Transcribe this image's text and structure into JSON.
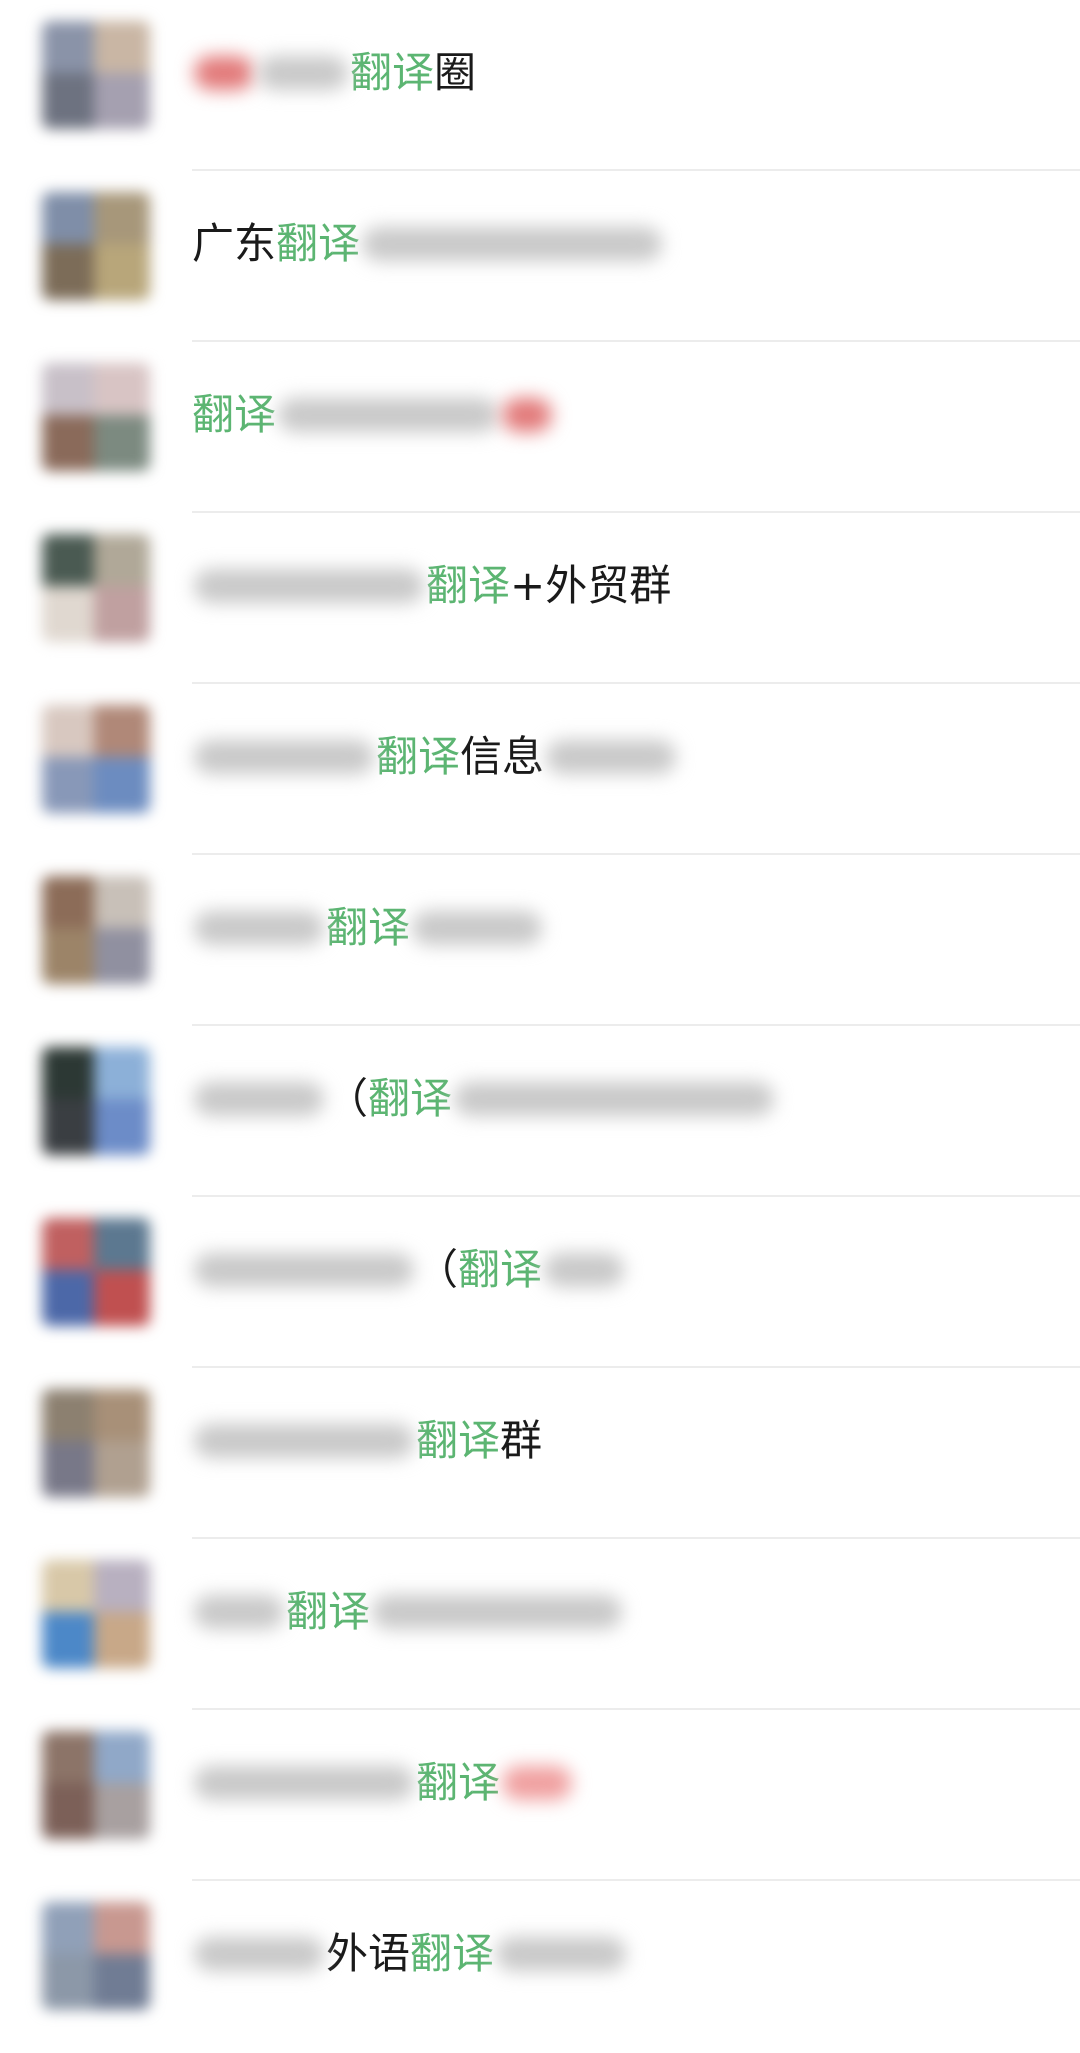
{
  "chats": [
    {
      "segments": [
        {
          "t": "blur",
          "w": 60,
          "c": "red"
        },
        {
          "t": "blur",
          "w": 90
        },
        {
          "t": "hl",
          "v": "翻译"
        },
        {
          "t": "txt",
          "v": "圈"
        }
      ],
      "avatar": [
        "#8a93a8",
        "#c9b6a4",
        "#6d7280",
        "#a5a0b0"
      ]
    },
    {
      "segments": [
        {
          "t": "txt",
          "v": "广东"
        },
        {
          "t": "hl",
          "v": "翻译"
        },
        {
          "t": "blur",
          "w": 300
        }
      ],
      "avatar": [
        "#7f8ea8",
        "#a7977a",
        "#7c6c58",
        "#b8a67a"
      ]
    },
    {
      "segments": [
        {
          "t": "hl",
          "v": "翻译"
        },
        {
          "t": "blur",
          "w": 220
        },
        {
          "t": "blur",
          "w": 50,
          "c": "red"
        }
      ],
      "avatar": [
        "#c8c0c8",
        "#d8c4c4",
        "#8a6a5a",
        "#7c8a80"
      ]
    },
    {
      "segments": [
        {
          "t": "blur",
          "w": 230
        },
        {
          "t": "hl",
          "v": "翻译"
        },
        {
          "t": "txt",
          "v": "+外贸群"
        }
      ],
      "avatar": [
        "#4a5a52",
        "#b0a898",
        "#e0d8d0",
        "#c0a0a0"
      ]
    },
    {
      "segments": [
        {
          "t": "blur",
          "w": 180
        },
        {
          "t": "hl",
          "v": "翻译"
        },
        {
          "t": "txt",
          "v": "信息"
        },
        {
          "t": "blur",
          "w": 130
        }
      ],
      "avatar": [
        "#d8c8c0",
        "#b08878",
        "#8898b8",
        "#6c8cc0"
      ]
    },
    {
      "segments": [
        {
          "t": "blur",
          "w": 130
        },
        {
          "t": "hl",
          "v": "翻译"
        },
        {
          "t": "blur",
          "w": 130
        }
      ],
      "avatar": [
        "#8c6c58",
        "#c8c0b8",
        "#9c8468",
        "#9090a0"
      ]
    },
    {
      "segments": [
        {
          "t": "blur",
          "w": 130
        },
        {
          "t": "txt",
          "v": "（"
        },
        {
          "t": "hl",
          "v": "翻译"
        },
        {
          "t": "blur",
          "w": 320
        }
      ],
      "avatar": [
        "#2c3834",
        "#8cb0d8",
        "#3a3e42",
        "#6c8cc8"
      ]
    },
    {
      "segments": [
        {
          "t": "blur",
          "w": 220
        },
        {
          "t": "txt",
          "v": "（"
        },
        {
          "t": "hl",
          "v": "翻译"
        },
        {
          "t": "blur",
          "w": 80
        }
      ],
      "avatar": [
        "#c06060",
        "#5c7890",
        "#4c68a8",
        "#c05050"
      ]
    },
    {
      "segments": [
        {
          "t": "blur",
          "w": 220
        },
        {
          "t": "hl",
          "v": "翻译"
        },
        {
          "t": "txt",
          "v": "群"
        }
      ],
      "avatar": [
        "#8c8070",
        "#a89078",
        "#787888",
        "#b0a090"
      ]
    },
    {
      "segments": [
        {
          "t": "blur",
          "w": 90
        },
        {
          "t": "hl",
          "v": "翻译"
        },
        {
          "t": "blur",
          "w": 250
        }
      ],
      "avatar": [
        "#d8c8a8",
        "#b8b0c0",
        "#4c88c8",
        "#c8a888"
      ]
    },
    {
      "segments": [
        {
          "t": "blur",
          "w": 220
        },
        {
          "t": "hl",
          "v": "翻译"
        },
        {
          "t": "blur",
          "w": 70,
          "c": "pink"
        }
      ],
      "avatar": [
        "#8c7468",
        "#90a8c8",
        "#7c6058",
        "#a8a0a0"
      ]
    },
    {
      "segments": [
        {
          "t": "blur",
          "w": 130
        },
        {
          "t": "txt",
          "v": "外语"
        },
        {
          "t": "hl",
          "v": "翻译"
        },
        {
          "t": "blur",
          "w": 130
        }
      ],
      "avatar": [
        "#90a0b8",
        "#c89890",
        "#8c98a8",
        "#707c94"
      ]
    }
  ]
}
